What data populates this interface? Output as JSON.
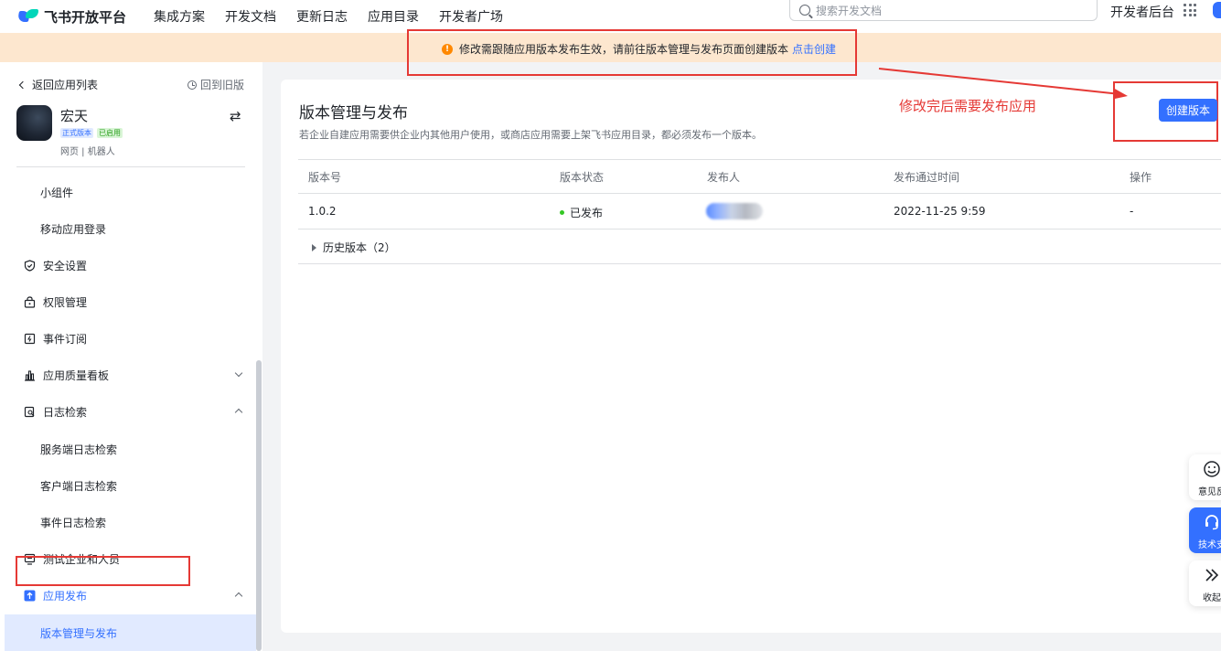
{
  "topbar": {
    "logo_text": "飞书开放平台",
    "nav": [
      "集成方案",
      "开发文档",
      "更新日志",
      "应用目录",
      "开发者广场"
    ],
    "search_placeholder": "搜索开发文档",
    "dev_backend": "开发者后台"
  },
  "banner": {
    "text": "修改需跟随应用版本发布生效，请前往版本管理与发布页面创建版本",
    "link": "点击创建"
  },
  "sidebar": {
    "back": "返回应用列表",
    "old_version": "回到旧版",
    "app_name": "宏天",
    "tag_version": "正式版本",
    "tag_status": "已启用",
    "app_meta": "网页 | 机器人",
    "items": [
      {
        "label": "小组件",
        "type": "sub"
      },
      {
        "label": "移动应用登录",
        "type": "sub"
      },
      {
        "label": "安全设置",
        "type": "top",
        "icon": "shield-icon"
      },
      {
        "label": "权限管理",
        "type": "top",
        "icon": "lock-icon"
      },
      {
        "label": "事件订阅",
        "type": "top",
        "icon": "event-icon"
      },
      {
        "label": "应用质量看板",
        "type": "top",
        "icon": "bar-chart-icon"
      },
      {
        "label": "日志检索",
        "type": "top",
        "icon": "log-search-icon"
      },
      {
        "label": "服务端日志检索",
        "type": "sub"
      },
      {
        "label": "客户端日志检索",
        "type": "sub"
      },
      {
        "label": "事件日志检索",
        "type": "sub"
      },
      {
        "label": "测试企业和人员",
        "type": "top",
        "icon": "test-icon"
      },
      {
        "label": "应用发布",
        "type": "top",
        "icon": "publish-icon"
      },
      {
        "label": "版本管理与发布",
        "type": "sub"
      }
    ]
  },
  "main": {
    "title": "版本管理与发布",
    "description": "若企业自建应用需要供企业内其他用户使用，或商店应用需要上架飞书应用目录，都必须发布一个版本。",
    "annotation": "修改完后需要发布应用",
    "create_button": "创建版本",
    "table": {
      "headers": [
        "版本号",
        "版本状态",
        "发布人",
        "发布通过时间",
        "操作"
      ],
      "rows": [
        {
          "version": "1.0.2",
          "status": "已发布",
          "publisher": "",
          "time": "2022-11-25 9:59",
          "action": "-"
        }
      ]
    },
    "history": "历史版本（2）"
  },
  "floating": {
    "feedback": "意见反",
    "support": "技术支",
    "collapse": "收起"
  },
  "colors": {
    "accent": "#3370ff",
    "banner_bg": "#fde7cf",
    "annotation_red": "#e53935",
    "status_green": "#34c724"
  }
}
